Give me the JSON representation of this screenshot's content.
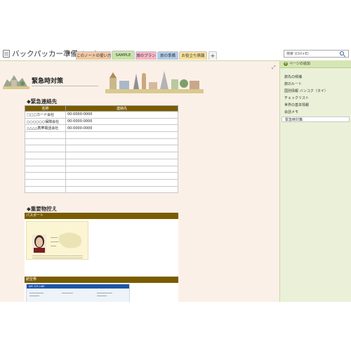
{
  "notebook": {
    "title": "バックパッカー準備ノート",
    "dropdown_glyph": "▼"
  },
  "tabs": [
    {
      "label": "このノートの使い方"
    },
    {
      "label": "SAMPLE"
    },
    {
      "label": "旅のプラン"
    },
    {
      "label": "旅の準備"
    },
    {
      "label": "お役立ち情報"
    },
    {
      "label": "+"
    }
  ],
  "search": {
    "placeholder": "検索 (Ctrl+E)"
  },
  "page": {
    "title": "緊急時対策",
    "sections": {
      "contacts": "◆緊急連絡先",
      "documents": "◆重要物控え"
    },
    "contacts_table": {
      "headers": [
        "名称",
        "連絡先"
      ],
      "rows": [
        [
          "□□□カード会社",
          "00-0000-0000"
        ],
        [
          "○○○○○○保険会社",
          "00-0000-0000"
        ],
        [
          "△△△△携帯電話会社",
          "00-0000-0000"
        ],
        [
          "",
          ""
        ],
        [
          "",
          ""
        ],
        [
          "",
          ""
        ],
        [
          "",
          ""
        ],
        [
          "",
          ""
        ],
        [
          "",
          ""
        ],
        [
          "",
          ""
        ],
        [
          "",
          ""
        ],
        [
          "",
          ""
        ]
      ]
    },
    "documents": {
      "passport_label": "パスポート",
      "ticket_label": "航空券",
      "ticket_header": "AIR 123 LINE"
    }
  },
  "sidebar": {
    "add_page": "ページの追加",
    "pages": [
      {
        "label": "旅先の候補"
      },
      {
        "label": "旅のルート"
      },
      {
        "label": "国別情報 バンコク（タイ）"
      },
      {
        "label": "チェックリスト"
      },
      {
        "label": "世界の基本情報"
      },
      {
        "label": "会話メモ"
      },
      {
        "label": "緊急時対策",
        "active": true
      }
    ]
  },
  "colors": {
    "header_brown": "#7a5c00",
    "page_bg": "#fbf0e8",
    "sidebar_bg": "#eaf1d8",
    "accent_green": "#6a8f2a"
  }
}
